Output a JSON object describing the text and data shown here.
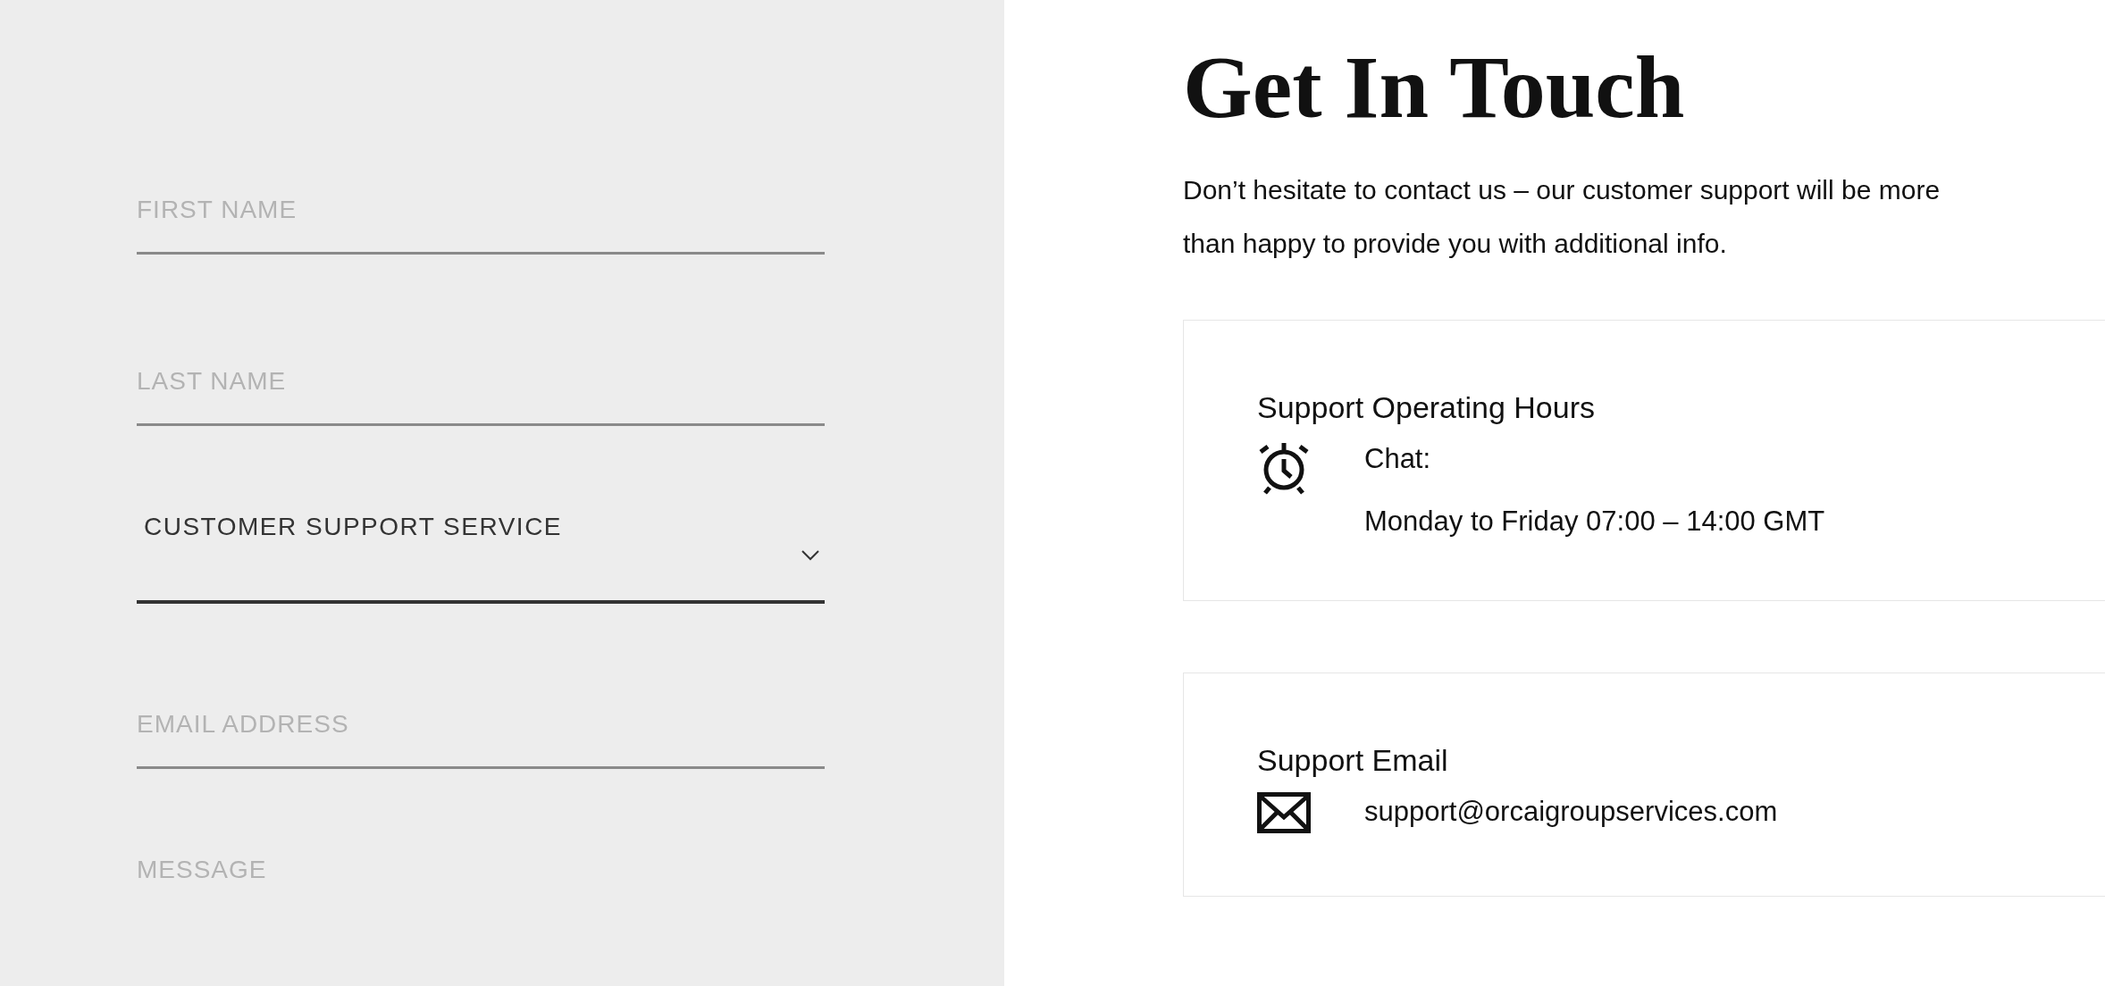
{
  "form": {
    "fields": [
      {
        "kind": "text",
        "placeholder": "FIRST NAME"
      },
      {
        "kind": "text",
        "placeholder": "LAST NAME"
      },
      {
        "kind": "select",
        "value": "CUSTOMER SUPPORT SERVICE"
      },
      {
        "kind": "text",
        "placeholder": "EMAIL ADDRESS"
      },
      {
        "kind": "textarea",
        "placeholder": "MESSAGE"
      }
    ]
  },
  "contact": {
    "title": "Get In Touch",
    "intro": "Don’t hesitate to contact us – our customer support will be more than happy to provide you with additional info.",
    "cards": [
      {
        "kind": "hours",
        "title": "Support Operating Hours",
        "lines": [
          "Chat:",
          "Monday to Friday 07:00 – 14:00 GMT"
        ]
      },
      {
        "kind": "email",
        "title": "Support Email",
        "lines": [
          "support@orcaigroupservices.com"
        ]
      }
    ]
  }
}
